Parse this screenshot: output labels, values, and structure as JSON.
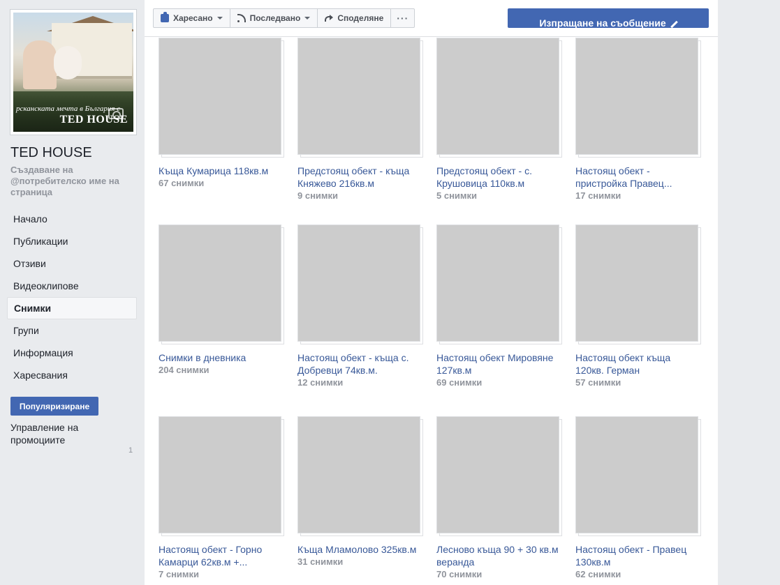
{
  "page": {
    "name": "TED HOUSE",
    "username_prompt": "Създаване на @потребителско име на страница",
    "profile_slogan": "рсканската мечта в България с",
    "profile_brand": "TED HOUSE"
  },
  "nav": [
    {
      "label": "Начало",
      "active": false
    },
    {
      "label": "Публикации",
      "active": false
    },
    {
      "label": "Отзиви",
      "active": false
    },
    {
      "label": "Видеоклипове",
      "active": false
    },
    {
      "label": "Снимки",
      "active": true
    },
    {
      "label": "Групи",
      "active": false
    },
    {
      "label": "Информация",
      "active": false
    },
    {
      "label": "Харесвания",
      "active": false
    }
  ],
  "promote": {
    "button_label": "Популяризиране",
    "manage_label": "Управление на промоциите",
    "count": "1"
  },
  "actions": {
    "liked_label": "Харесано",
    "following_label": "Последвано",
    "share_label": "Споделяне",
    "more_label": "···",
    "message_label": "Изпращане на съобщение"
  },
  "albums": [
    {
      "title": "Къща Кумарица 118кв.м",
      "count": "67 снимки",
      "scene": "p-pool"
    },
    {
      "title": "Предстоящ обект - къща Княжево 216кв.м",
      "count": "9 снимки",
      "scene": "p-house-a"
    },
    {
      "title": "Предстоящ обект - с. Крушовица 110кв.м",
      "count": "5 снимки",
      "scene": "p-house-b"
    },
    {
      "title": "Настоящ обект - пристройка Правец...",
      "count": "17 снимки",
      "scene": "p-house-c"
    },
    {
      "title": "Снимки в дневника",
      "count": "204 снимки",
      "scene": "p-road"
    },
    {
      "title": "Настоящ обект - къща с. Добревци 74кв.м.",
      "count": "12 снимки",
      "scene": "p-house-d"
    },
    {
      "title": "Настоящ обект Мировяне 127кв.м",
      "count": "69 снимки",
      "scene": "p-house-e"
    },
    {
      "title": "Настоящ обект къща 120кв. Герман",
      "count": "57 снимки",
      "scene": "p-house-f"
    },
    {
      "title": "Настоящ обект - Горно Камарци 62кв.м +...",
      "count": "7 снимки",
      "scene": "p-house-g"
    },
    {
      "title": "Къща Мламолово 325кв.м",
      "count": "31 снимки",
      "scene": "p-house-h"
    },
    {
      "title": "Лесново къща 90 + 30 кв.м веранда",
      "count": "70 снимки",
      "scene": "p-night"
    },
    {
      "title": "Настоящ обект - Правец 130кв.м",
      "count": "62 снимки",
      "scene": "p-house-i"
    }
  ],
  "colors": {
    "brand_blue": "#4267b2",
    "link_blue": "#385898",
    "muted_gray": "#90949c",
    "page_bg": "#e9ebee"
  }
}
